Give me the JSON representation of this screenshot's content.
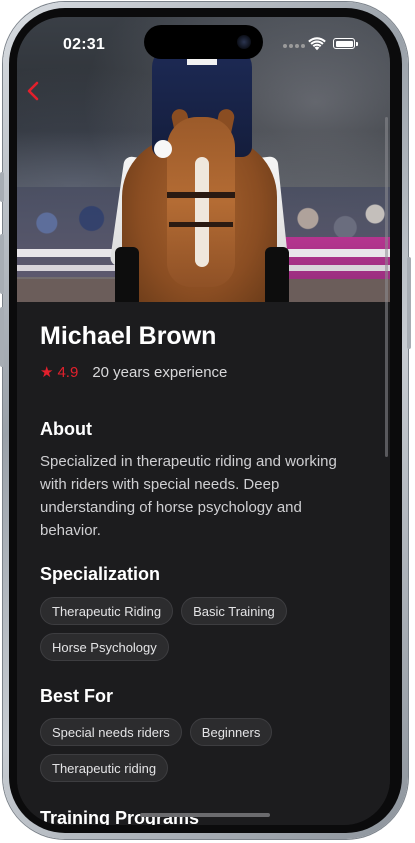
{
  "status_bar": {
    "time": "02:31"
  },
  "icons": {
    "back": "chevron-left-icon",
    "star": "star-icon",
    "wifi": "wifi-icon",
    "battery": "battery-icon"
  },
  "colors": {
    "accent": "#e3202c",
    "background": "#1c1c1e",
    "chip_bg": "#2c2c2e",
    "text_primary": "#ffffff",
    "text_secondary": "#cfcfd2"
  },
  "trainer": {
    "name": "Michael Brown",
    "rating": "4.9",
    "experience": "20 years experience"
  },
  "about": {
    "title": "About",
    "text": "Specialized in therapeutic riding and working with riders with special needs. Deep understanding of horse psychology and behavior."
  },
  "specialization": {
    "title": "Specialization",
    "tags": [
      "Therapeutic Riding",
      "Basic Training",
      "Horse Psychology"
    ]
  },
  "best_for": {
    "title": "Best For",
    "tags": [
      "Special needs riders",
      "Beginners",
      "Therapeutic riding"
    ]
  },
  "training_programs": {
    "title": "Training Programs"
  }
}
